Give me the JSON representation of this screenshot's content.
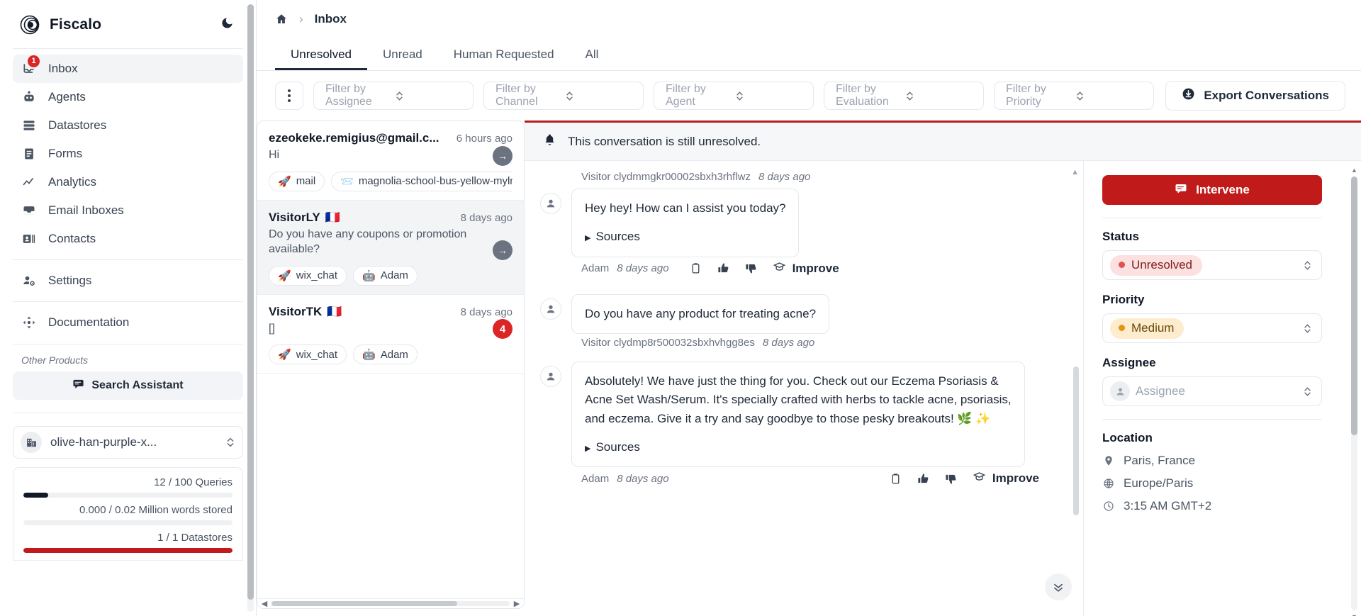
{
  "sidebar": {
    "brand": "Fiscalo",
    "dark_mode_icon": "moon-icon",
    "nav": [
      {
        "label": "Inbox",
        "icon": "inbox-icon",
        "badge": "1",
        "active": true
      },
      {
        "label": "Agents",
        "icon": "robot-icon",
        "badge": "",
        "active": false
      },
      {
        "label": "Datastores",
        "icon": "database-icon",
        "badge": "",
        "active": false
      },
      {
        "label": "Forms",
        "icon": "form-icon",
        "badge": "",
        "active": false
      },
      {
        "label": "Analytics",
        "icon": "chart-line-icon",
        "badge": "",
        "active": false
      },
      {
        "label": "Email Inboxes",
        "icon": "email-inbox-icon",
        "badge": "",
        "active": false
      },
      {
        "label": "Contacts",
        "icon": "contacts-icon",
        "badge": "",
        "active": false
      }
    ],
    "settings": {
      "label": "Settings",
      "icon": "user-gear-icon"
    },
    "documentation": {
      "label": "Documentation",
      "icon": "move-icon"
    },
    "other_products_label": "Other Products",
    "search_assistant": {
      "label": "Search Assistant",
      "icon": "chat-icon"
    },
    "datastore_select": {
      "value": "olive-han-purple-x...",
      "icon": "building-icon"
    },
    "usage": [
      {
        "text": "12 / 100 Queries",
        "percent": 12,
        "color": "#111827"
      },
      {
        "text": "0.000 / 0.02 Million words stored",
        "percent": 0,
        "color": "#111827"
      },
      {
        "text": "1 / 1 Datastores",
        "percent": 100,
        "color": "#c01a1a"
      }
    ]
  },
  "breadcrumb": {
    "home_icon": "home-icon",
    "separator": "›",
    "current": "Inbox"
  },
  "tabs": [
    {
      "label": "Unresolved",
      "active": true
    },
    {
      "label": "Unread",
      "active": false
    },
    {
      "label": "Human Requested",
      "active": false
    },
    {
      "label": "All",
      "active": false
    }
  ],
  "filters": {
    "kebab_icon": "more-vertical-icon",
    "items": [
      {
        "placeholder": "Filter by Assignee"
      },
      {
        "placeholder": "Filter by Channel"
      },
      {
        "placeholder": "Filter by Agent"
      },
      {
        "placeholder": "Filter by Evaluation"
      },
      {
        "placeholder": "Filter by Priority"
      }
    ],
    "export": {
      "label": "Export Conversations",
      "icon": "download-icon"
    }
  },
  "conversations": [
    {
      "title": "ezeokeke.remigius@gmail.c...",
      "flag": "",
      "time": "6 hours ago",
      "preview": "Hi",
      "tags": [
        {
          "label": "mail",
          "icon": "rocket-icon"
        },
        {
          "label": "magnolia-school-bus-yellow-mylm",
          "icon": "envelope-icon"
        }
      ],
      "action": "arrow-right-icon",
      "unread": "",
      "selected": false
    },
    {
      "title": "VisitorLY",
      "flag": "🇫🇷",
      "time": "8 days ago",
      "preview": "Do you have any coupons or promotion available?",
      "tags": [
        {
          "label": "wix_chat",
          "icon": "rocket-icon"
        },
        {
          "label": "Adam",
          "icon": "robot-icon"
        }
      ],
      "action": "arrow-right-icon",
      "unread": "",
      "selected": true
    },
    {
      "title": "VisitorTK",
      "flag": "🇫🇷",
      "time": "8 days ago",
      "preview": "[]",
      "tags": [
        {
          "label": "wix_chat",
          "icon": "rocket-icon"
        },
        {
          "label": "Adam",
          "icon": "robot-icon"
        }
      ],
      "action": "",
      "unread": "4",
      "selected": false
    }
  ],
  "banner": {
    "icon": "bell-icon",
    "text": "This conversation is still unresolved."
  },
  "thread": {
    "visitor_1": {
      "name": "Visitor clydmmgkr00002sbxh3rhflwz",
      "time": "8 days ago"
    },
    "msg_1": {
      "text": "Hey hey! How can I assist you today?",
      "sources_label": "Sources"
    },
    "msg_1_meta": {
      "who": "Adam",
      "time": "8 days ago",
      "improve": "Improve"
    },
    "msg_2": {
      "text": "Do you have any product for treating acne?"
    },
    "visitor_2": {
      "name": "Visitor clydmp8r500032sbxhvhgg8es",
      "time": "8 days ago"
    },
    "msg_3": {
      "text": "Absolutely! We have just the thing for you. Check out our Eczema Psoriasis & Acne Set Wash/Serum. It's specially crafted with herbs to tackle acne, psoriasis, and eczema. Give it a try and say goodbye to those pesky breakouts! 🌿 ✨",
      "sources_label": "Sources"
    },
    "msg_3_meta": {
      "who": "Adam",
      "time": "8 days ago",
      "improve": "Improve"
    },
    "icons": {
      "copy": "clipboard-icon",
      "up": "thumbs-up-icon",
      "down": "thumbs-down-icon",
      "improve": "graduation-cap-icon",
      "scroll_down": "double-chevron-down-icon"
    }
  },
  "info_panel": {
    "intervene": {
      "label": "Intervene",
      "icon": "chat-icon"
    },
    "status": {
      "label": "Status",
      "value": "Unresolved",
      "color": "#e05353"
    },
    "priority": {
      "label": "Priority",
      "value": "Medium",
      "color": "#e2950f"
    },
    "assignee": {
      "label": "Assignee",
      "placeholder": "Assignee",
      "icon": "person-icon"
    },
    "location": {
      "label": "Location",
      "rows": [
        {
          "text": "Paris, France",
          "icon": "map-pin-icon"
        },
        {
          "text": "Europe/Paris",
          "icon": "globe-icon"
        },
        {
          "text": "3:15 AM GMT+2",
          "icon": "clock-icon"
        }
      ]
    }
  }
}
